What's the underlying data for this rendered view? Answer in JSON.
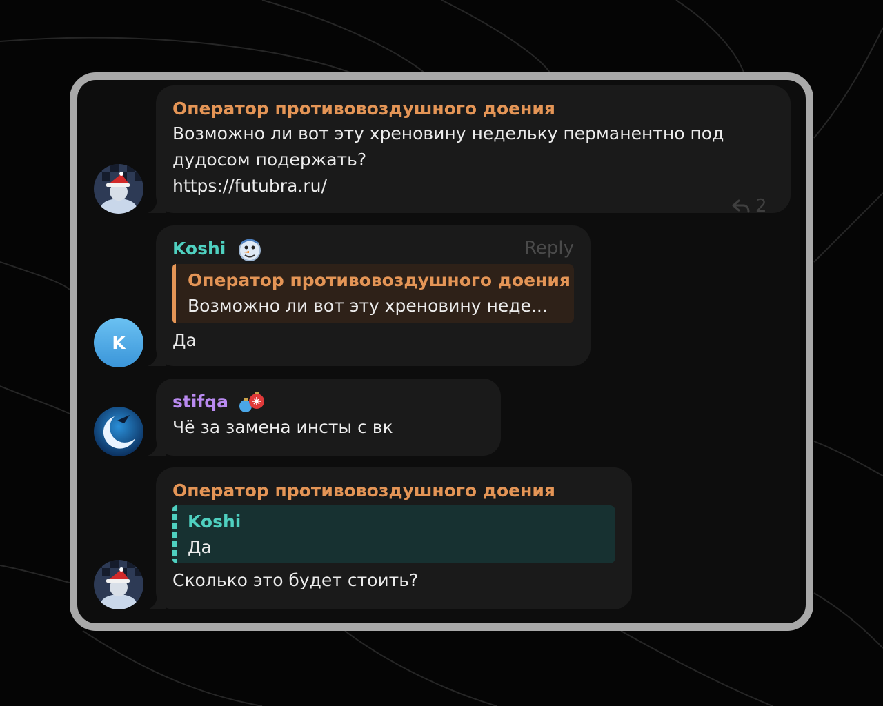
{
  "messages": [
    {
      "sender": "Оператор противовоздушного доения",
      "text_line1": "Возможно ли вот эту хреновину недельку перманентно под",
      "text_line2": "дудосом подержать?",
      "link": "https://futubra.ru/",
      "reply_count": "2",
      "colors": {
        "sender": "#e49556"
      }
    },
    {
      "sender": "Koshi",
      "reply_label": "Reply",
      "avatar_letter": "K",
      "quote": {
        "name": "Оператор противовоздушного доения",
        "text": "Возможно ли вот эту хреновину неде..."
      },
      "text": "Да",
      "colors": {
        "sender": "#4fd0c0"
      }
    },
    {
      "sender": "stifqa",
      "text": "Чё за замена инсты с вк",
      "colors": {
        "sender": "#b98af0"
      }
    },
    {
      "sender": "Оператор противовоздушного доения",
      "quote": {
        "name": "Koshi",
        "text": "Да"
      },
      "text": "Сколько это будет стоить?",
      "colors": {
        "sender": "#e49556"
      }
    }
  ],
  "icons": {
    "reply_count": "reply-arrow-icon",
    "koshi_badge": "snowman-emoji-icon",
    "stifqa_badge": "christmas-ornaments-emoji-icon"
  }
}
